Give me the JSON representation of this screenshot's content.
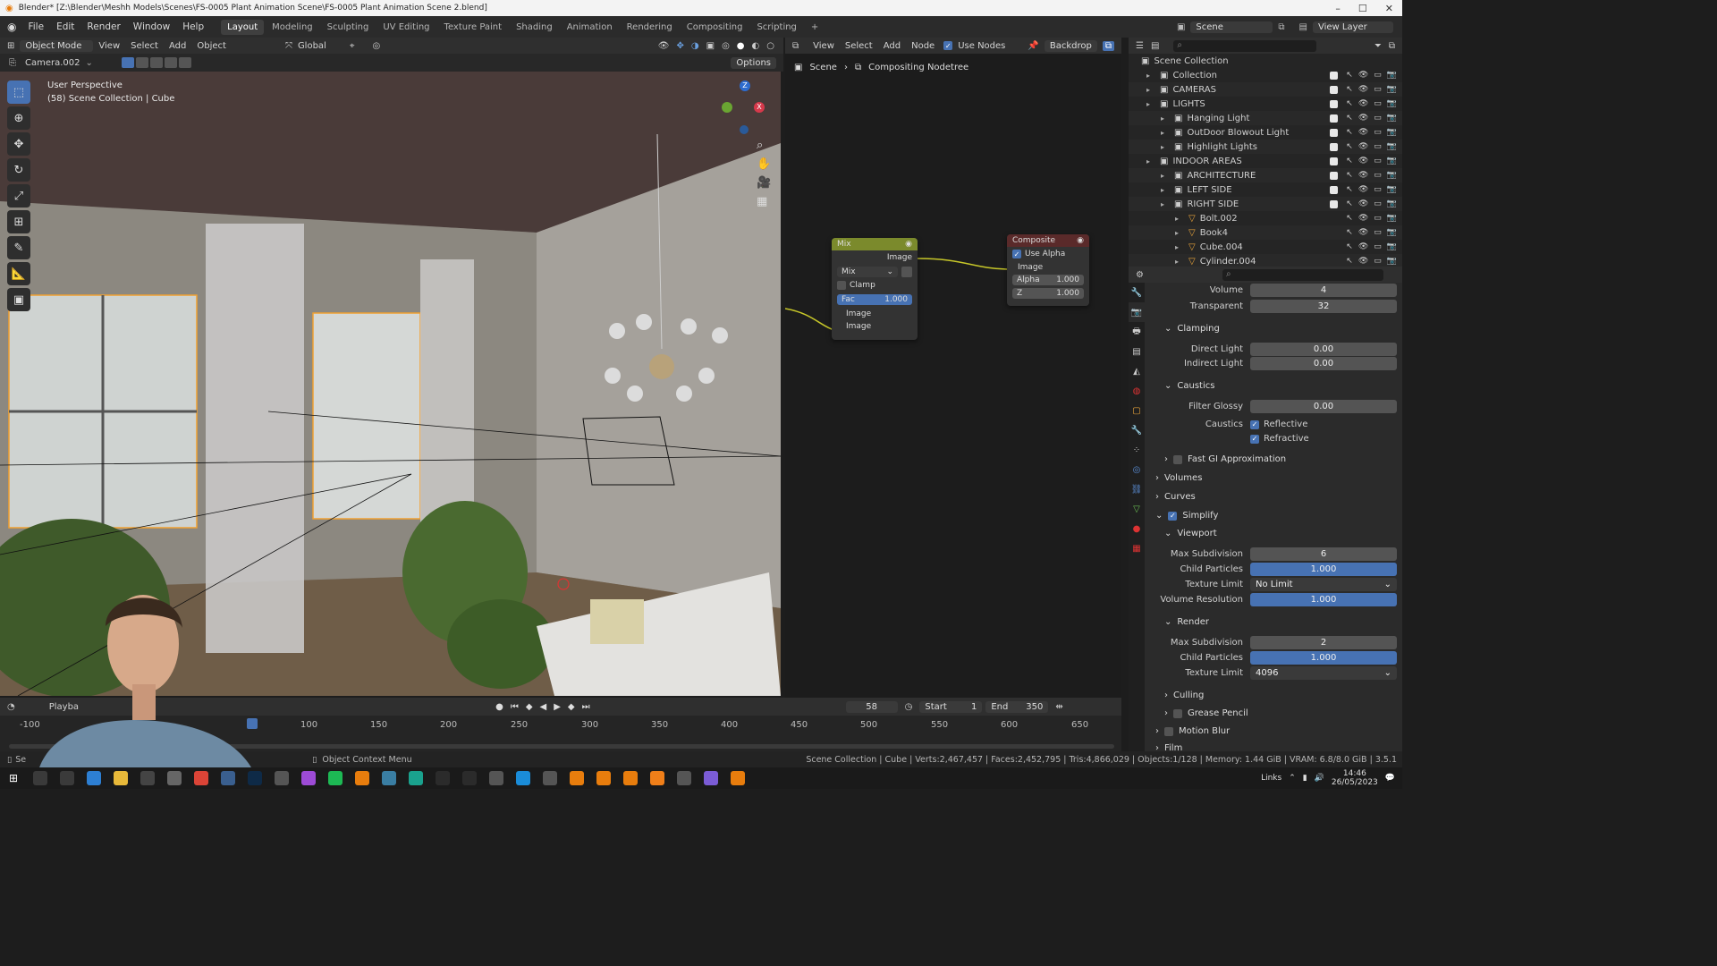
{
  "window": {
    "title": "Blender* [Z:\\Blender\\Meshh Models\\Scenes\\FS-0005 Plant Animation Scene\\FS-0005 Plant Animation Scene 2.blend]"
  },
  "menu": [
    "File",
    "Edit",
    "Render",
    "Window",
    "Help"
  ],
  "workspaces": [
    "Layout",
    "Modeling",
    "Sculpting",
    "UV Editing",
    "Texture Paint",
    "Shading",
    "Animation",
    "Rendering",
    "Compositing",
    "Scripting"
  ],
  "active_workspace": "Layout",
  "scene_selector": "Scene",
  "view_layer_selector": "View Layer",
  "viewport": {
    "mode": "Object Mode",
    "menus": [
      "View",
      "Select",
      "Add",
      "Object"
    ],
    "transform": "Global",
    "camera": "Camera.002",
    "options": "Options",
    "overlay_line1": "User Perspective",
    "overlay_line2": "(58) Scene Collection | Cube",
    "gizmo_axes": [
      "Z",
      "X"
    ]
  },
  "node_editor": {
    "menus": [
      "View",
      "Select",
      "Add",
      "Node"
    ],
    "use_nodes_label": "Use Nodes",
    "backdrop": "Backdrop",
    "breadcrumb": [
      "Scene",
      "Compositing Nodetree"
    ],
    "mix_node": {
      "title": "Mix",
      "output": "Image",
      "blend": "Mix",
      "clamp": "Clamp",
      "fac_label": "Fac",
      "fac_value": "1.000",
      "inputs": [
        "Image",
        "Image"
      ]
    },
    "composite_node": {
      "title": "Composite",
      "use_alpha": "Use Alpha",
      "input": "Image",
      "alpha_label": "Alpha",
      "alpha_value": "1.000",
      "z_label": "Z",
      "z_value": "1.000"
    }
  },
  "outliner": {
    "root": "Scene Collection",
    "items": [
      {
        "label": "Collection",
        "indent": 1
      },
      {
        "label": "CAMERAS",
        "indent": 1
      },
      {
        "label": "LIGHTS",
        "indent": 1
      },
      {
        "label": "Hanging Light",
        "indent": 2
      },
      {
        "label": "OutDoor Blowout Light",
        "indent": 2
      },
      {
        "label": "Highlight Lights",
        "indent": 2
      },
      {
        "label": "INDOOR AREAS",
        "indent": 1
      },
      {
        "label": "ARCHITECTURE",
        "indent": 2
      },
      {
        "label": "LEFT SIDE",
        "indent": 2
      },
      {
        "label": "RIGHT SIDE",
        "indent": 2
      },
      {
        "label": "Bolt.002",
        "indent": 3
      },
      {
        "label": "Book4",
        "indent": 3
      },
      {
        "label": "Cube.004",
        "indent": 3
      },
      {
        "label": "Cylinder.004",
        "indent": 3
      }
    ]
  },
  "properties": {
    "volume_label": "Volume",
    "volume_value": "4",
    "transparent_label": "Transparent",
    "transparent_value": "32",
    "clamping": "Clamping",
    "direct_light_label": "Direct Light",
    "direct_light_value": "0.00",
    "indirect_light_label": "Indirect Light",
    "indirect_light_value": "0.00",
    "caustics_section": "Caustics",
    "filter_glossy_label": "Filter Glossy",
    "filter_glossy_value": "0.00",
    "caustics_label": "Caustics",
    "reflective": "Reflective",
    "refractive": "Refractive",
    "fast_gi": "Fast GI Approximation",
    "volumes": "Volumes",
    "curves": "Curves",
    "simplify": "Simplify",
    "viewport_section": "Viewport",
    "vp_max_subdiv_label": "Max Subdivision",
    "vp_max_subdiv_value": "6",
    "vp_child_particles_label": "Child Particles",
    "vp_child_particles_value": "1.000",
    "vp_texture_limit_label": "Texture Limit",
    "vp_texture_limit_value": "No Limit",
    "vp_volume_res_label": "Volume Resolution",
    "vp_volume_res_value": "1.000",
    "render_section": "Render",
    "r_max_subdiv_label": "Max Subdivision",
    "r_max_subdiv_value": "2",
    "r_child_particles_label": "Child Particles",
    "r_child_particles_value": "1.000",
    "r_texture_limit_label": "Texture Limit",
    "r_texture_limit_value": "4096",
    "culling": "Culling",
    "grease_pencil": "Grease Pencil",
    "motion_blur": "Motion Blur",
    "film": "Film"
  },
  "timeline": {
    "playback": "Playba",
    "current_frame": "58",
    "start_label": "Start",
    "start_value": "1",
    "end_label": "End",
    "end_value": "350",
    "ticks": [
      "-100",
      "100",
      "150",
      "200",
      "250",
      "300",
      "350",
      "400",
      "450",
      "500",
      "550",
      "600",
      "650"
    ]
  },
  "statusbar": {
    "left": "Se",
    "context": "Object Context Menu",
    "stats": "Scene Collection | Cube | Verts:2,467,457 | Faces:2,452,795 | Tris:4,866,029 | Objects:1/128 | Memory: 1.44 GiB | VRAM: 6.8/8.0 GiB | 3.5.1"
  },
  "taskbar": {
    "links": "Links",
    "time": "14:46",
    "date": "26/05/2023"
  },
  "colors": {
    "accent_blue": "#4772b3",
    "active_orange": "#f0a030",
    "node_socket_yellow": "#c7c729",
    "mix_node_header": "#7b8a2c",
    "composite_node_header": "#5a2a2a"
  }
}
